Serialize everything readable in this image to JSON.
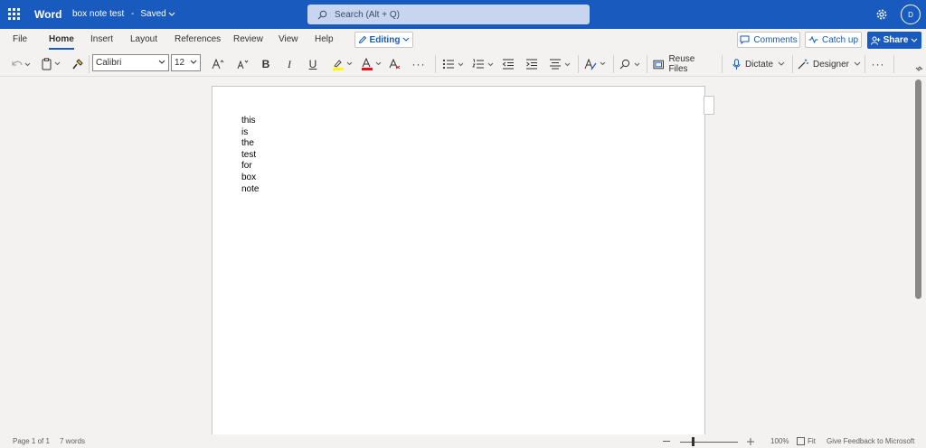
{
  "titlebar": {
    "app_name": "Word",
    "doc_title": "box note test",
    "separator": "-",
    "status": "Saved",
    "search_placeholder": "Search (Alt + Q)",
    "avatar_initial": "D"
  },
  "menu": {
    "tabs": [
      {
        "label": "File"
      },
      {
        "label": "Home"
      },
      {
        "label": "Insert"
      },
      {
        "label": "Layout"
      },
      {
        "label": "References"
      },
      {
        "label": "Review"
      },
      {
        "label": "View"
      },
      {
        "label": "Help"
      }
    ],
    "active_tab": "Home",
    "editing_label": "Editing",
    "comments_label": "Comments",
    "catchup_label": "Catch up",
    "share_label": "Share"
  },
  "ribbon": {
    "font_name": "Calibri",
    "font_size": "12",
    "reuse_files_label": "Reuse Files",
    "dictate_label": "Dictate",
    "designer_label": "Designer",
    "highlight_color": "#ffff00",
    "font_color": "#e81123"
  },
  "document": {
    "lines": [
      "this",
      "is",
      "the",
      "test",
      "for",
      "box",
      "note"
    ]
  },
  "statusbar": {
    "page_info": "Page 1 of 1",
    "word_count": "7 words",
    "zoom_level": "100%",
    "fit_label": "Fit",
    "feedback_label": "Give Feedback to Microsoft"
  },
  "colors": {
    "brand": "#185abd"
  }
}
